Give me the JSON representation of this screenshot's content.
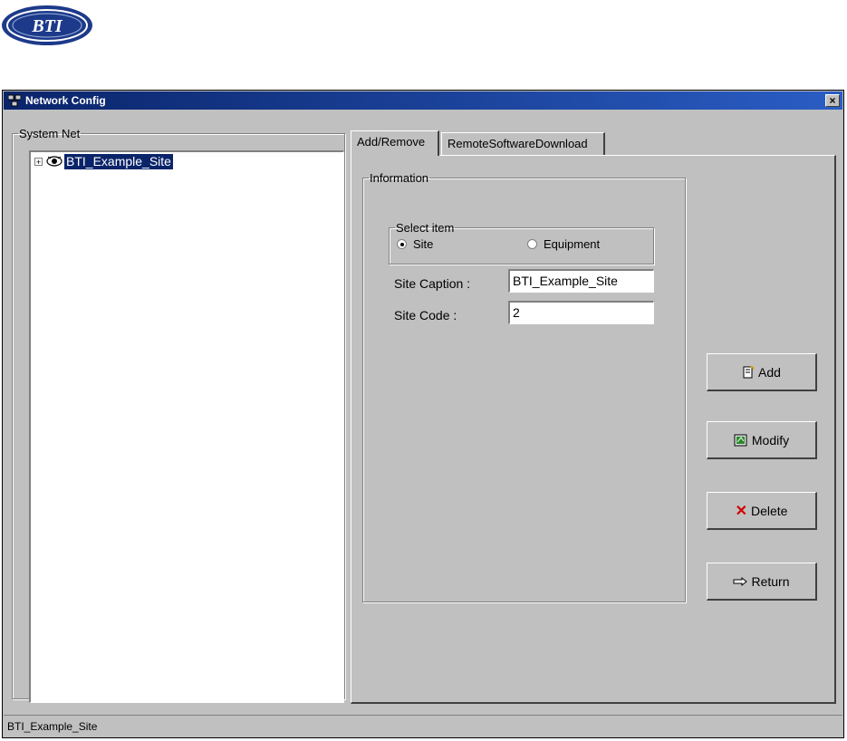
{
  "logo": {
    "text": "BTI"
  },
  "window": {
    "title": "Network Config",
    "close_label": "×"
  },
  "system_net": {
    "legend": "System Net",
    "tree": [
      {
        "label": "BTI_Example_Site",
        "expander": "+"
      }
    ]
  },
  "tabs": [
    {
      "label": "Add/Remove",
      "active": true
    },
    {
      "label": "RemoteSoftwareDownload",
      "active": false
    }
  ],
  "information": {
    "legend": "Information",
    "select_item": {
      "legend": "Select item",
      "options": [
        {
          "label": "Site",
          "selected": true
        },
        {
          "label": "Equipment",
          "selected": false
        }
      ]
    },
    "site_caption": {
      "label": "Site Caption :",
      "value": "BTI_Example_Site"
    },
    "site_code": {
      "label": "Site Code :",
      "value": "2"
    }
  },
  "buttons": {
    "add": "Add",
    "modify": "Modify",
    "delete": "Delete",
    "return": "Return"
  },
  "status": {
    "text": "BTI_Example_Site"
  },
  "colors": {
    "titlebar": "#0a246a",
    "face": "#c0c0c0",
    "selection": "#0a246a"
  }
}
